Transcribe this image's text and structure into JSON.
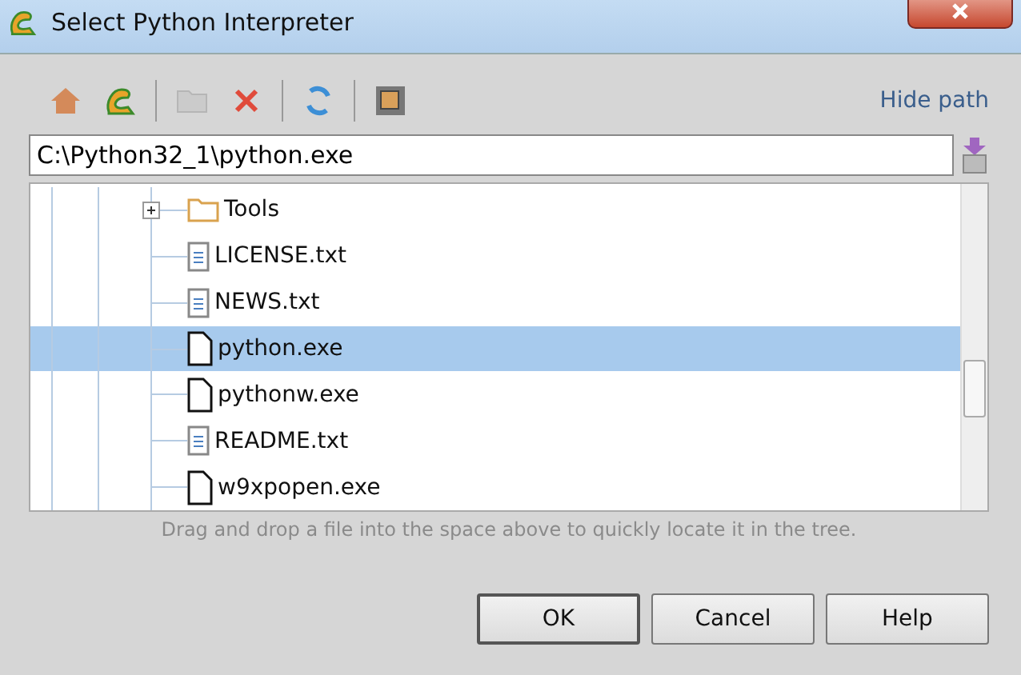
{
  "window": {
    "title": "Select Python Interpreter"
  },
  "toolbar": [
    {
      "kind": "home",
      "disabled": false
    },
    {
      "kind": "python",
      "disabled": false
    },
    {
      "kind": "separator"
    },
    {
      "kind": "new-folder",
      "disabled": true
    },
    {
      "kind": "delete",
      "disabled": false
    },
    {
      "kind": "separator"
    },
    {
      "kind": "refresh",
      "disabled": false
    },
    {
      "kind": "separator"
    },
    {
      "kind": "hidden",
      "disabled": false
    }
  ],
  "hide_path": "Hide path",
  "path_field": {
    "value": "C:\\Python32_1\\python.exe"
  },
  "tree": [
    {
      "kind": "folder",
      "name": "Tools",
      "expanded": false,
      "selected": false
    },
    {
      "kind": "text",
      "name": "LICENSE.txt",
      "selected": false
    },
    {
      "kind": "text",
      "name": "NEWS.txt",
      "selected": false
    },
    {
      "kind": "exe",
      "name": "python.exe",
      "selected": true
    },
    {
      "kind": "exe",
      "name": "pythonw.exe",
      "selected": false
    },
    {
      "kind": "text",
      "name": "README.txt",
      "selected": false
    },
    {
      "kind": "exe",
      "name": "w9xpopen.exe",
      "selected": false
    }
  ],
  "hint": "Drag and drop a file into the space above to quickly locate it in the tree.",
  "buttons": [
    {
      "label": "OK",
      "default": true
    },
    {
      "label": "Cancel",
      "default": false
    },
    {
      "label": "Help",
      "default": false
    }
  ]
}
